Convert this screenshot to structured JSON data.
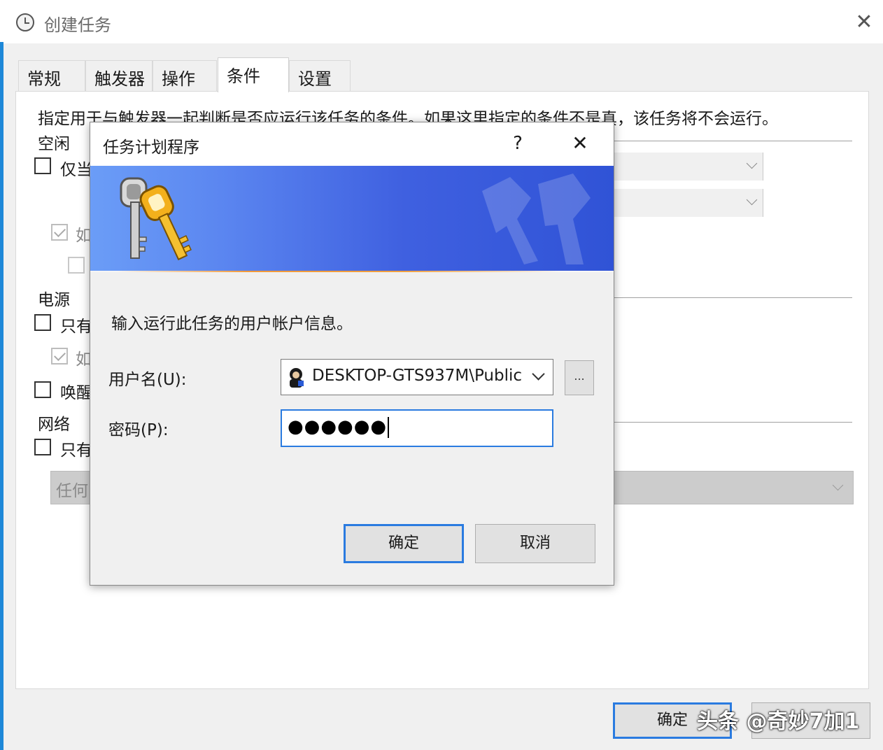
{
  "window": {
    "title": "创建任务",
    "close_glyph": "✕"
  },
  "tabs": [
    {
      "label": "常规"
    },
    {
      "label": "触发器"
    },
    {
      "label": "操作"
    },
    {
      "label": "条件"
    },
    {
      "label": "设置"
    }
  ],
  "conditions": {
    "description": "指定用于与触发器一起判断是否应运行该任务的条件。如果这里指定的条件不是真，该任务将不会运行。",
    "idle": {
      "group_label": "空闲",
      "start_only_if_idle": {
        "label": "仅当",
        "checked": false
      },
      "stop_if_not_idle": {
        "label": "如",
        "checked": true
      },
      "restart_if_idle_resumes": {
        "label": "",
        "checked": false
      }
    },
    "power": {
      "group_label": "电源",
      "only_on_ac": {
        "label": "只有",
        "checked": false
      },
      "stop_on_battery": {
        "label": "如",
        "checked": true
      },
      "wake_to_run": {
        "label": "唤醒",
        "checked": false
      }
    },
    "network": {
      "group_label": "网络",
      "only_if_network": {
        "label": "只有",
        "checked": false
      },
      "connection_value": "任何"
    }
  },
  "footer": {
    "ok_label": "确定",
    "watermark": "头条 @奇妙7加1"
  },
  "dialog": {
    "title": "任务计划程序",
    "help_glyph": "?",
    "close_glyph": "✕",
    "prompt": "输入运行此任务的用户帐户信息。",
    "user_label": "用户名(U):",
    "user_value": "DESKTOP-GTS937M\\Public",
    "browse_label": "...",
    "password_label": "密码(P):",
    "password_mask": "●●●●●●",
    "ok_label": "确定",
    "cancel_label": "取消"
  },
  "colors": {
    "accent_blue": "#2a7be0",
    "banner_blue": "#3f60e0",
    "banner_orange": "#f29a3a"
  }
}
